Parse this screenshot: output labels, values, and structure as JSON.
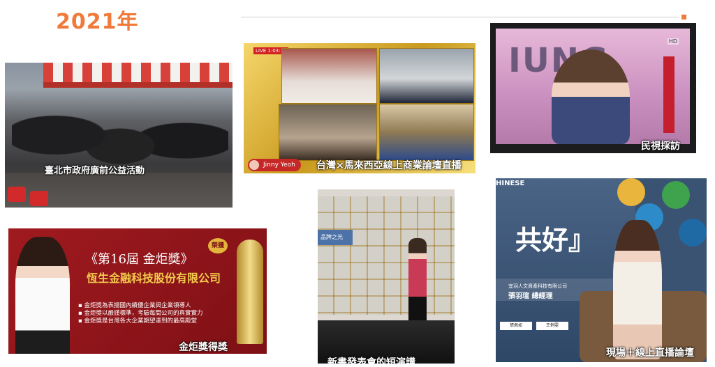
{
  "header": {
    "year": "2021年"
  },
  "photos": {
    "street": {
      "caption": "臺北市政府廣前公益活動"
    },
    "online": {
      "caption": "台灣×馬來西亞線上商業論壇直播",
      "live_tag": "LIVE 1:03:19",
      "host_name": "Jinny Yeoh"
    },
    "tv": {
      "caption": "民視採訪",
      "backdrop_text": "IUNG",
      "channel_tag": "HD"
    },
    "award": {
      "caption": "金炬獎得獎",
      "title": "《第16屆  金炬獎》",
      "company": "恆生金融科技股份有限公司",
      "badge": "榮獲",
      "lines": [
        "金炬獎為表揚國內績優企業與企業領導人",
        "金炬獎以嚴謹標準，考驗每間公司的真實實力",
        "金炬獎是台灣各大企業期望達到的最高殿堂"
      ]
    },
    "launch": {
      "caption": "新書發表會的短演講",
      "wall_sign": "品牌之光"
    },
    "forum": {
      "caption": "現場＋線上直播論壇",
      "corner_text": "HINESE",
      "backdrop_text": "共好』",
      "speaker_title": "張羽瑄 總經理",
      "speaker_org": "宜羽人文資產科技有限公司",
      "tag_left": "張佩如",
      "tag_right": "王俐雯"
    }
  }
}
